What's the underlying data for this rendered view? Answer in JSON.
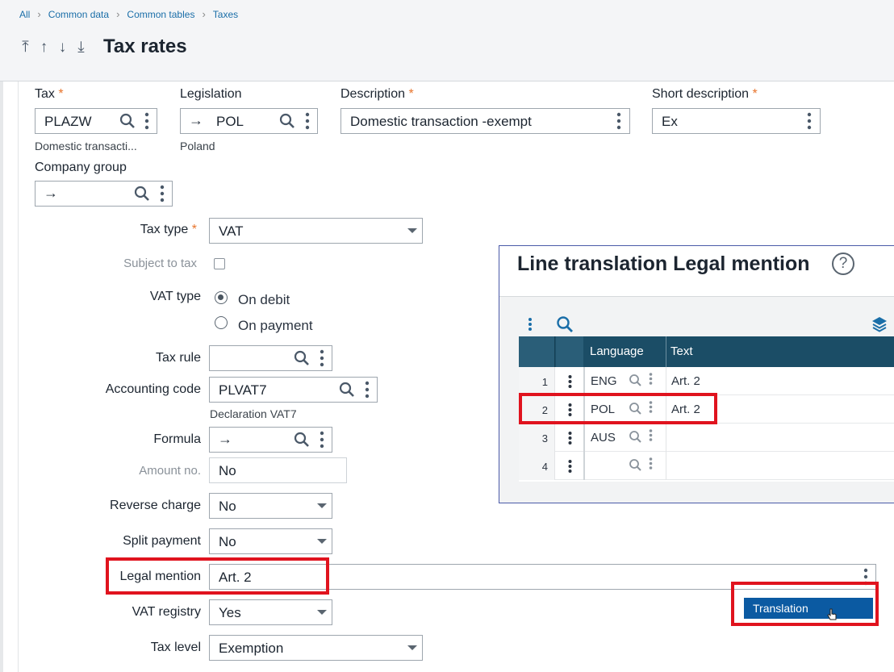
{
  "breadcrumb": [
    "All",
    "Common data",
    "Common tables",
    "Taxes"
  ],
  "page_title": "Tax rates",
  "fields": {
    "tax": {
      "label": "Tax",
      "value": "PLAZW",
      "subtext": "Domestic transacti..."
    },
    "legislation": {
      "label": "Legislation",
      "value": "POL",
      "subtext": "Poland"
    },
    "description": {
      "label": "Description",
      "value": "Domestic transaction -exempt"
    },
    "short_description": {
      "label": "Short description",
      "value": "Ex"
    },
    "company_group": {
      "label": "Company group",
      "value": ""
    },
    "tax_type": {
      "label": "Tax type",
      "value": "VAT"
    },
    "subject_to_tax": {
      "label": "Subject to tax",
      "checked": false
    },
    "vat_type": {
      "label": "VAT type",
      "options": [
        "On debit",
        "On payment"
      ],
      "selected": "On debit"
    },
    "tax_rule": {
      "label": "Tax rule",
      "value": ""
    },
    "accounting_code": {
      "label": "Accounting code",
      "value": "PLVAT7",
      "subtext": "Declaration VAT7"
    },
    "formula": {
      "label": "Formula",
      "value": ""
    },
    "amount_no": {
      "label": "Amount no.",
      "value": "No"
    },
    "reverse_charge": {
      "label": "Reverse charge",
      "value": "No"
    },
    "split_payment": {
      "label": "Split payment",
      "value": "No"
    },
    "legal_mention": {
      "label": "Legal mention",
      "value": "Art. 2"
    },
    "vat_registry": {
      "label": "VAT registry",
      "value": "Yes"
    },
    "tax_level": {
      "label": "Tax level",
      "value": "Exemption"
    }
  },
  "required_marker": "*",
  "translation_panel": {
    "title": "Line translation Legal mention",
    "help": "?",
    "columns": [
      "Language",
      "Text"
    ],
    "rows": [
      {
        "num": "1",
        "language": "ENG",
        "text": "Art. 2"
      },
      {
        "num": "2",
        "language": "POL",
        "text": "Art. 2"
      },
      {
        "num": "3",
        "language": "AUS",
        "text": ""
      },
      {
        "num": "4",
        "language": "",
        "text": ""
      }
    ]
  },
  "context_menu": {
    "item": "Translation"
  },
  "colors": {
    "accent": "#1b4d66",
    "required": "#e8742c",
    "highlight": "#e0131e",
    "menu_selected": "#0b5aa2"
  }
}
